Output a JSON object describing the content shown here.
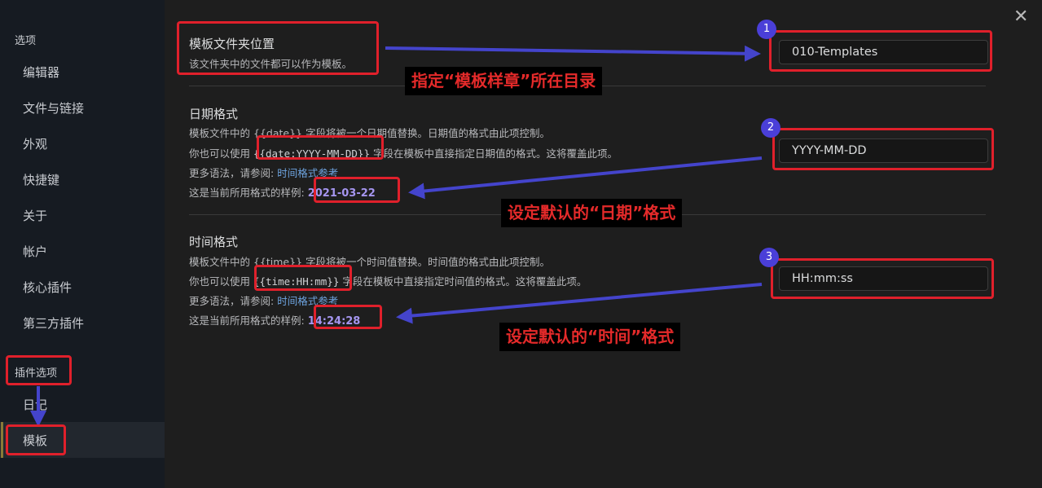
{
  "sidebar": {
    "options_heading": "选项",
    "items": [
      {
        "label": "编辑器"
      },
      {
        "label": "文件与链接"
      },
      {
        "label": "外观"
      },
      {
        "label": "快捷键"
      },
      {
        "label": "关于"
      },
      {
        "label": "帐户"
      },
      {
        "label": "核心插件"
      },
      {
        "label": "第三方插件"
      }
    ],
    "plugin_options_heading": "插件选项",
    "plugin_items": [
      {
        "label": "日记"
      },
      {
        "label": "模板"
      }
    ]
  },
  "settings": {
    "template_folder": {
      "title": "模板文件夹位置",
      "description": "该文件夹中的文件都可以作为模板。",
      "value": "010-Templates"
    },
    "date_format": {
      "title": "日期格式",
      "desc_line1": "模板文件中的 {{date}} 字段将被一个日期值替换。日期值的格式由此项控制。",
      "desc_line2_prefix": "你也可以使用 ",
      "desc_line2_code": "{{date:YYYY-MM-DD}}",
      "desc_line2_suffix": " 字段在模板中直接指定日期值的格式。这将覆盖此项。",
      "more_prefix": "更多语法，请参阅: ",
      "more_link": "时间格式参考",
      "sample_prefix": "这是当前所用格式的样例: ",
      "sample_value": "2021-03-22",
      "value": "YYYY-MM-DD"
    },
    "time_format": {
      "title": "时间格式",
      "desc_line1": "模板文件中的 {{time}} 字段将被一个时间值替换。时间值的格式由此项控制。",
      "desc_line2_prefix": "你也可以使用 ",
      "desc_line2_code": "{{time:HH:mm}}",
      "desc_line2_suffix": " 字段在模板中直接指定时间值的格式。这将覆盖此项。",
      "more_prefix": "更多语法，请参阅: ",
      "more_link": "时间格式参考",
      "sample_prefix": "这是当前所用格式的样例: ",
      "sample_value": "14:24:28",
      "value": "HH:mm:ss"
    }
  },
  "annotations": {
    "badges": [
      "1",
      "2",
      "3"
    ],
    "callout_folder": "指定“模板样章”所在目录",
    "callout_date": "设定默认的“日期”格式",
    "callout_time": "设定默认的“时间”格式"
  },
  "colors": {
    "annotation_red": "#e0202b",
    "arrow_blue": "#4444cc",
    "badge_blue": "#4a3fd8",
    "sample_purple": "#a596f0",
    "link_blue": "#6ea4e0"
  },
  "icons": {
    "close": "close-icon"
  }
}
